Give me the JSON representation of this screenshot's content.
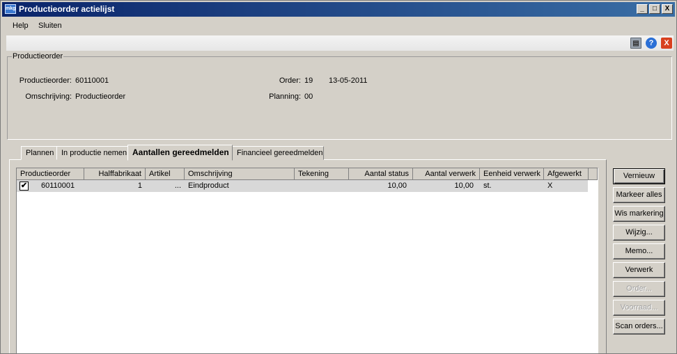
{
  "window": {
    "title": "Productieorder actielijst",
    "icon_text": "mkg",
    "controls": {
      "minimize": "_",
      "maximize": "□",
      "close": "X"
    }
  },
  "menu": {
    "items": [
      "Help",
      "Sluiten"
    ]
  },
  "toolbar": {
    "icons": [
      "printer-icon",
      "help-icon",
      "close-icon"
    ],
    "help_glyph": "?",
    "close_glyph": "X"
  },
  "header_group": {
    "legend": "Productieorder",
    "productieorder_label": "Productieorder:",
    "productieorder_value": "60110001",
    "omschrijving_label": "Omschrijving:",
    "omschrijving_value": "Productieorder",
    "order_label": "Order:",
    "order_value": "19",
    "order_date": "13-05-2011",
    "planning_label": "Planning:",
    "planning_value": "00"
  },
  "tabs": [
    {
      "label": "Plannen",
      "active": false
    },
    {
      "label": "In productie nemen",
      "active": false
    },
    {
      "label": "Aantallen gereedmelden",
      "active": true
    },
    {
      "label": "Financieel gereedmelden",
      "active": false
    }
  ],
  "table": {
    "columns": [
      "Productieorder",
      "Halffabrikaat",
      "Artikel",
      "Omschrijving",
      "Tekening",
      "Aantal status",
      "Aantal verwerk",
      "Eenheid verwerk",
      "Afgewerkt"
    ],
    "rows": [
      {
        "checked": true,
        "check_glyph": "✔",
        "productieorder": "60110001",
        "halffabrikaat": "1",
        "artikel": "...",
        "omschrijving": "Eindproduct",
        "tekening": "",
        "aantal_status": "10,00",
        "aantal_verwerk": "10,00",
        "eenheid_verwerk": "st.",
        "afgewerkt": "X"
      }
    ]
  },
  "buttons": {
    "vernieuw": "Vernieuw",
    "markeer_alles": "Markeer alles",
    "wis_markering": "Wis markering",
    "wijzig": "Wijzig...",
    "memo": "Memo...",
    "verwerk": "Verwerk",
    "order": "Order...",
    "voorraad": "Voorraad...",
    "scan_orders": "Scan orders..."
  }
}
